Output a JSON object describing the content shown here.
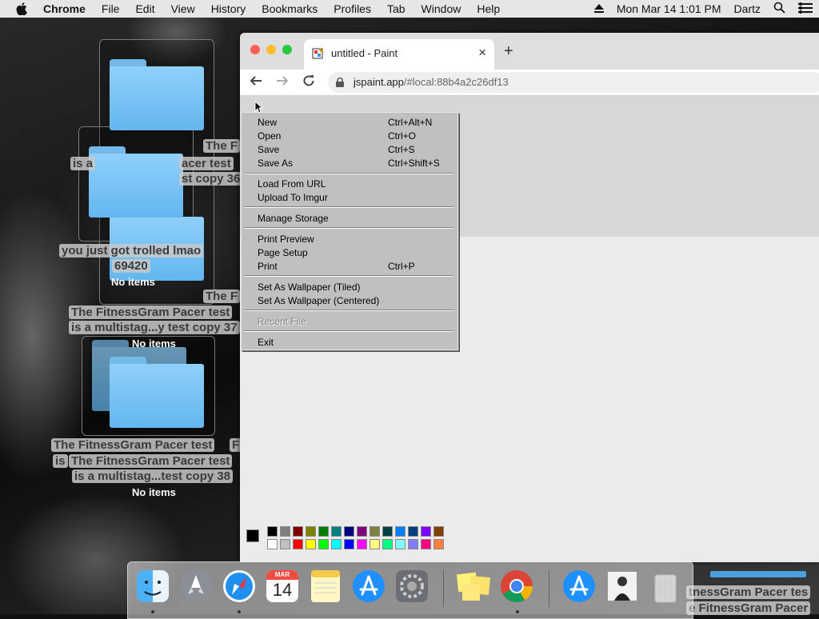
{
  "menubar": {
    "app_name": "Chrome",
    "menus": [
      "File",
      "Edit",
      "View",
      "History",
      "Bookmarks",
      "Profiles",
      "Tab",
      "Window",
      "Help"
    ],
    "datetime": "Mon Mar 14  1:01 PM",
    "user": "Dartz"
  },
  "desktop": {
    "labels": {
      "troll_line1": "you just got trolled lmao",
      "troll_line2": "69420",
      "no_items_1": "No items",
      "no_items_2": "No items",
      "no_items_3": "No items",
      "fitness_a_line1": "The FitnessGram Pacer test",
      "fitness_a_line2": "is a multistag...y test copy 37",
      "fitness_b_line1": "The FitnessGram Pacer test",
      "fitness_b_line2": "is a multistag...test copy 38",
      "partial_1": "The F",
      "partial_2": "The F",
      "partial_3": "The F",
      "partial_4": "acer test",
      "partial_5": "st copy 36",
      "partial_6": "is a",
      "partial_7": "is",
      "partial_8": "F",
      "partial_9": "tnessGram Pacer tes",
      "partial_10": "e FitnessGram Pacer"
    }
  },
  "browser": {
    "tab_title": "untitled - Paint",
    "url_host": "jspaint.app",
    "url_rest": "/#local:88b4a2c26df13"
  },
  "file_menu": {
    "items": [
      {
        "label": "New",
        "shortcut": "Ctrl+Alt+N"
      },
      {
        "label": "Open",
        "shortcut": "Ctrl+O"
      },
      {
        "label": "Save",
        "shortcut": "Ctrl+S"
      },
      {
        "label": "Save As",
        "shortcut": "Ctrl+Shift+S"
      },
      {
        "label": "Load From URL",
        "shortcut": ""
      },
      {
        "label": "Upload To Imgur",
        "shortcut": ""
      },
      {
        "label": "Manage Storage",
        "shortcut": ""
      },
      {
        "label": "Print Preview",
        "shortcut": ""
      },
      {
        "label": "Page Setup",
        "shortcut": ""
      },
      {
        "label": "Print",
        "shortcut": "Ctrl+P"
      },
      {
        "label": "Set As Wallpaper (Tiled)",
        "shortcut": ""
      },
      {
        "label": "Set As Wallpaper (Centered)",
        "shortcut": ""
      },
      {
        "label": "Recent File",
        "shortcut": ""
      },
      {
        "label": "Exit",
        "shortcut": ""
      }
    ]
  },
  "palette": {
    "row1": [
      "#000000",
      "#808080",
      "#800000",
      "#808000",
      "#008000",
      "#008080",
      "#000080",
      "#800080",
      "#808040",
      "#004040",
      "#0080ff",
      "#004080",
      "#8000ff",
      "#804000"
    ],
    "row2": [
      "#ffffff",
      "#c0c0c0",
      "#ff0000",
      "#ffff00",
      "#00ff00",
      "#00ffff",
      "#0000ff",
      "#ff00ff",
      "#ffff80",
      "#00ff80",
      "#80ffff",
      "#8080ff",
      "#ff0080",
      "#ff8040"
    ]
  },
  "dock": {
    "calendar_month": "MAR",
    "calendar_day": "14"
  }
}
